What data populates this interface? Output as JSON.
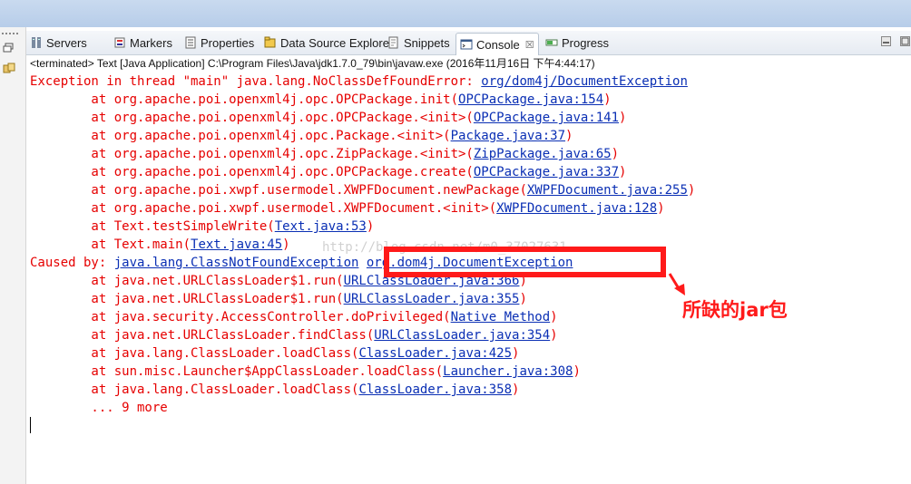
{
  "tabs": [
    {
      "label": "Servers",
      "icon": "servers-icon"
    },
    {
      "label": "Markers",
      "icon": "markers-icon"
    },
    {
      "label": "Properties",
      "icon": "properties-icon"
    },
    {
      "label": "Data Source Explorer",
      "icon": "data-source-icon"
    },
    {
      "label": "Snippets",
      "icon": "snippets-icon"
    },
    {
      "label": "Console",
      "icon": "console-icon",
      "active": true,
      "close": "☒"
    },
    {
      "label": "Progress",
      "icon": "progress-icon"
    }
  ],
  "status": "<terminated> Text [Java Application] C:\\Program Files\\Java\\jdk1.7.0_79\\bin\\javaw.exe (2016年11月16日 下午4:44:17)",
  "console": {
    "lines": [
      {
        "pre": "Exception in thread \"main\" java.lang.NoClassDefFoundError: ",
        "link": "org/dom4j/DocumentException",
        "post": ""
      },
      {
        "pre": "\tat org.apache.poi.openxml4j.opc.OPCPackage.init(",
        "link": "OPCPackage.java:154",
        "post": ")"
      },
      {
        "pre": "\tat org.apache.poi.openxml4j.opc.OPCPackage.<init>(",
        "link": "OPCPackage.java:141",
        "post": ")"
      },
      {
        "pre": "\tat org.apache.poi.openxml4j.opc.Package.<init>(",
        "link": "Package.java:37",
        "post": ")"
      },
      {
        "pre": "\tat org.apache.poi.openxml4j.opc.ZipPackage.<init>(",
        "link": "ZipPackage.java:65",
        "post": ")"
      },
      {
        "pre": "\tat org.apache.poi.openxml4j.opc.OPCPackage.create(",
        "link": "OPCPackage.java:337",
        "post": ")"
      },
      {
        "pre": "\tat org.apache.poi.xwpf.usermodel.XWPFDocument.newPackage(",
        "link": "XWPFDocument.java:255",
        "post": ")"
      },
      {
        "pre": "\tat org.apache.poi.xwpf.usermodel.XWPFDocument.<init>(",
        "link": "XWPFDocument.java:128",
        "post": ")"
      },
      {
        "pre": "\tat Text.testSimpleWrite(",
        "link": "Text.java:53",
        "post": ")"
      },
      {
        "pre": "\tat Text.main(",
        "link": "Text.java:45",
        "post": ")"
      },
      {
        "pre": "Caused by: ",
        "link": "java.lang.ClassNotFoundException",
        "post": " ",
        "link2": "org.dom4j.DocumentException"
      },
      {
        "pre": "\tat java.net.URLClassLoader$1.run(",
        "link": "URLClassLoader.java:366",
        "post": ")"
      },
      {
        "pre": "\tat java.net.URLClassLoader$1.run(",
        "link": "URLClassLoader.java:355",
        "post": ")"
      },
      {
        "pre": "\tat java.security.AccessController.doPrivileged(",
        "link": "Native Method",
        "post": ")"
      },
      {
        "pre": "\tat java.net.URLClassLoader.findClass(",
        "link": "URLClassLoader.java:354",
        "post": ")"
      },
      {
        "pre": "\tat java.lang.ClassLoader.loadClass(",
        "link": "ClassLoader.java:425",
        "post": ")"
      },
      {
        "pre": "\tat sun.misc.Launcher$AppClassLoader.loadClass(",
        "link": "Launcher.java:308",
        "post": ")"
      },
      {
        "pre": "\tat java.lang.ClassLoader.loadClass(",
        "link": "ClassLoader.java:358",
        "post": ")"
      },
      {
        "pre": "\t... 9 more",
        "link": "",
        "post": ""
      }
    ]
  },
  "watermark": "http://blog.csdn.net/m0_37027631",
  "annotation": "所缺的jar包",
  "colors": {
    "error_text": "#e60000",
    "link": "#0a2fb4",
    "highlight": "#ff1a1a"
  }
}
